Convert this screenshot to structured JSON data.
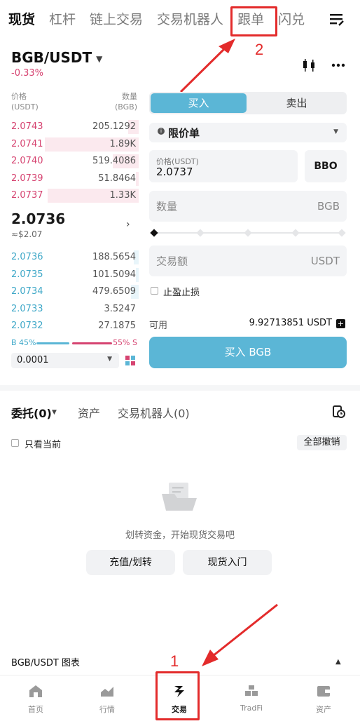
{
  "top_tabs": [
    "现货",
    "杠杆",
    "链上交易",
    "交易机器人",
    "跟单",
    "闪兑"
  ],
  "annotations": {
    "step1": "1",
    "step2": "2"
  },
  "pair": {
    "name": "BGB/USDT",
    "change": "-0.33%"
  },
  "orderbook": {
    "price_header": "价格",
    "price_unit": "(USDT)",
    "qty_header": "数量",
    "qty_unit": "(BGB)",
    "asks": [
      {
        "price": "2.0743",
        "qty": "205.1292",
        "depth": 0.08
      },
      {
        "price": "2.0741",
        "qty": "1.89K",
        "depth": 0.72
      },
      {
        "price": "2.0740",
        "qty": "519.4086",
        "depth": 0.2
      },
      {
        "price": "2.0739",
        "qty": "51.8464",
        "depth": 0.02
      },
      {
        "price": "2.0737",
        "qty": "1.33K",
        "depth": 0.7
      }
    ],
    "last_price": "2.0736",
    "last_usd": "≈$2.07",
    "bids": [
      {
        "price": "2.0736",
        "qty": "188.5654",
        "depth": 0.04
      },
      {
        "price": "2.0735",
        "qty": "101.5094",
        "depth": 0.02
      },
      {
        "price": "2.0734",
        "qty": "479.6509",
        "depth": 0.06
      },
      {
        "price": "2.0733",
        "qty": "3.5247",
        "depth": 0.0
      },
      {
        "price": "2.0732",
        "qty": "27.1875",
        "depth": 0.0
      }
    ],
    "buy_ratio_label": "B 45%",
    "sell_ratio_label": "55% S",
    "buy_ratio": 0.45,
    "precision": "0.0001"
  },
  "form": {
    "buy_tab": "买入",
    "sell_tab": "卖出",
    "order_type": "限价单",
    "price_label": "价格(USDT)",
    "price_value": "2.0737",
    "bbo": "BBO",
    "qty_placeholder": "数量",
    "qty_unit": "BGB",
    "amount_placeholder": "交易额",
    "amount_unit": "USDT",
    "tpsl_label": "止盈止损",
    "available_label": "可用",
    "available_value": "9.92713851 USDT",
    "submit": "买入 BGB"
  },
  "orders": {
    "tabs": [
      "委托(0)",
      "资产",
      "交易机器人(0)"
    ],
    "only_current": "只看当前",
    "cancel_all": "全部撤销",
    "empty_text": "划转资金，开始现货交易吧",
    "deposit_btn": "充值/划转",
    "guide_btn": "现货入门"
  },
  "chart_bar": "BGB/USDT 图表",
  "nav": [
    "首页",
    "行情",
    "交易",
    "TradFi",
    "资产"
  ],
  "colors": {
    "accent": "#5bb6d6",
    "down": "#d64471",
    "up": "#3fa8c8",
    "annotation": "#e32b2b"
  }
}
